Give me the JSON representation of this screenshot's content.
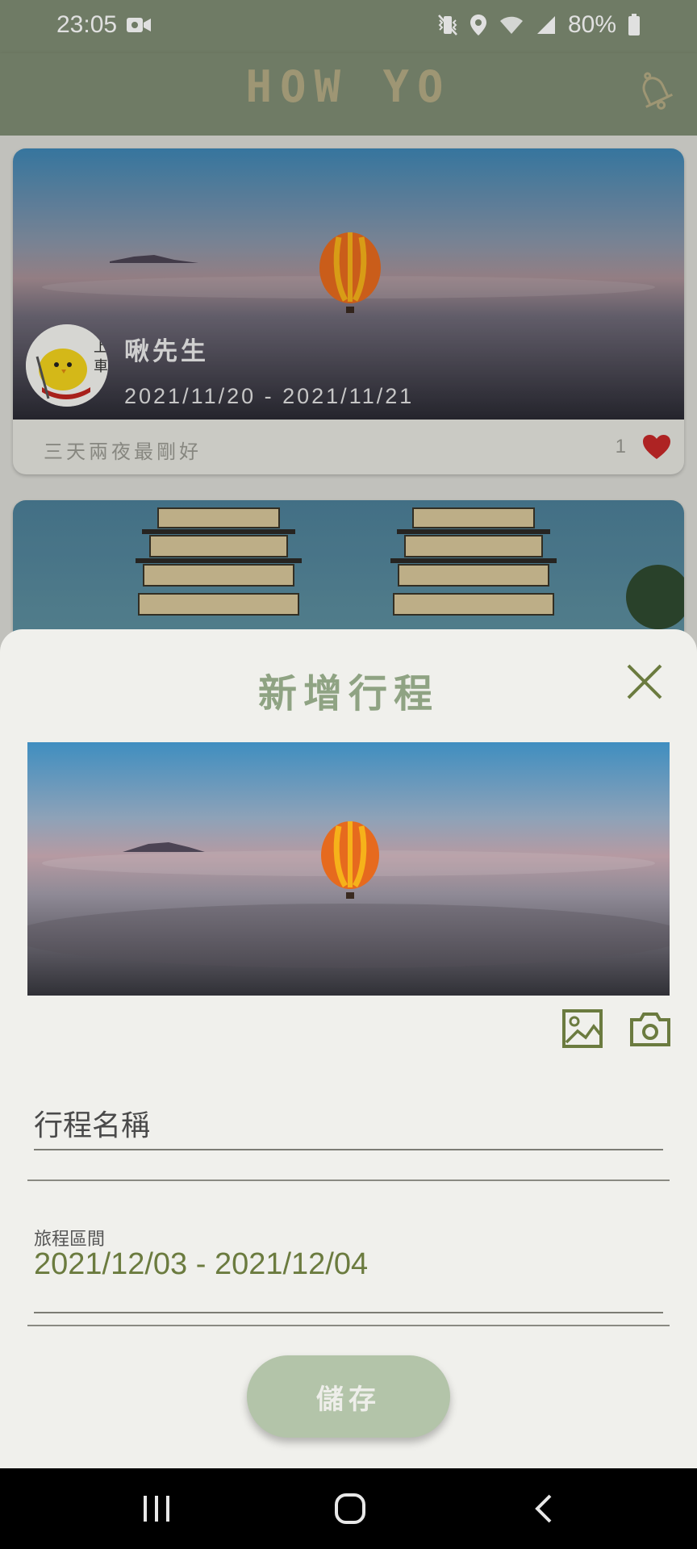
{
  "status_bar": {
    "time": "23:05",
    "battery": "80%",
    "icons": [
      "video-camera-icon",
      "vibrate-icon",
      "location-icon",
      "wifi-icon",
      "signal-icon",
      "battery-icon"
    ]
  },
  "app_bar": {
    "title": "HOW YO",
    "notification_icon": "bell-icon"
  },
  "feed": {
    "cards": [
      {
        "author": "啾先生",
        "dates": "2021/11/20 - 2021/11/21",
        "caption": "三天兩夜最剛好",
        "likes": "1",
        "image": "hot-air-balloon-over-fog",
        "avatar": "yellow-chick-sticker"
      },
      {
        "image": "dragon-tiger-pagodas"
      }
    ]
  },
  "sheet": {
    "title": "新增行程",
    "close_icon": "close-icon",
    "preview_image": "hot-air-balloon-over-fog",
    "gallery_icon": "image-icon",
    "camera_icon": "camera-icon",
    "name_placeholder": "行程名稱",
    "range_label": "旅程區間",
    "range_value": "2021/12/03 - 2021/12/04",
    "save_label": "儲存"
  },
  "nav_bar": {
    "icons": [
      "recents-icon",
      "home-icon",
      "back-icon"
    ]
  },
  "colors": {
    "app_bar": "#7f8c73",
    "accent_green": "#8fa383",
    "date_green": "#6b7b3f",
    "save_button": "#b3c4a9",
    "heart": "#c62828"
  }
}
